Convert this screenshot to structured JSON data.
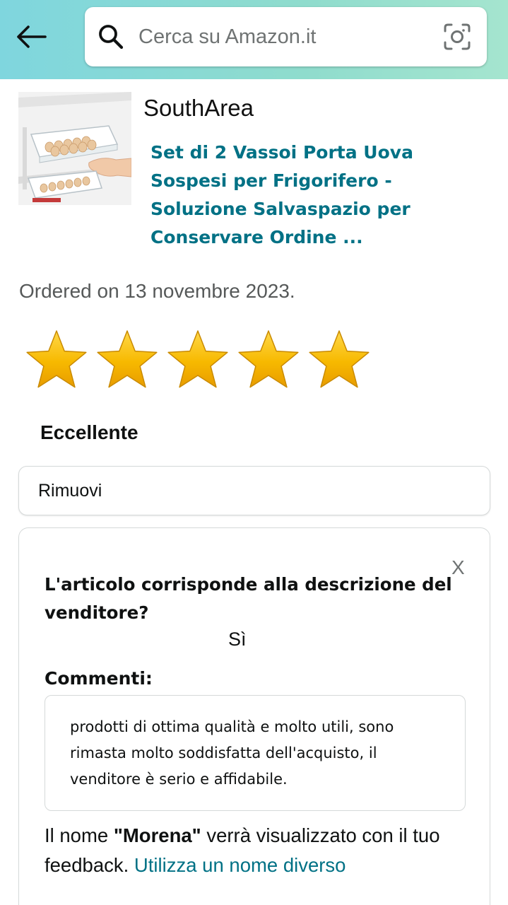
{
  "header": {
    "search_placeholder": "Cerca su Amazon.it",
    "search_value": "",
    "back_icon": "arrow-left-icon",
    "search_icon": "magnifier-icon",
    "camera_icon": "camera-scan-icon"
  },
  "product": {
    "seller": "SouthArea",
    "title": "Set di 2 Vassoi Porta Uova Sospesi per Frigorifero - Soluzione Salvaspazio per Conservare Ordine ...",
    "ordered": "Ordered on 13 novembre 2023."
  },
  "rating": {
    "value": 5,
    "max": 5,
    "label": "Eccellente",
    "star_color": "#f7b900"
  },
  "remove_label": "Rimuovi",
  "feedback": {
    "close_label": "X",
    "question": "L'articolo corrisponde alla descrizione del venditore?",
    "answer": "Sì",
    "comments_label": "Commenti:",
    "comment_text": "prodotti di ottima qualità e molto utili, sono rimasta molto soddisfatta dell'acquisto, il venditore è serio e affidabile.",
    "name_prefix": "Il nome ",
    "name": "\"Morena\"",
    "name_suffix": " verrà visualizzato con il tuo feedback. ",
    "use_other_name": "Utilizza un nome diverso"
  },
  "colors": {
    "header_gradient_start": "#7fd6de",
    "header_gradient_end": "#a5e5cf",
    "link": "#007185"
  }
}
